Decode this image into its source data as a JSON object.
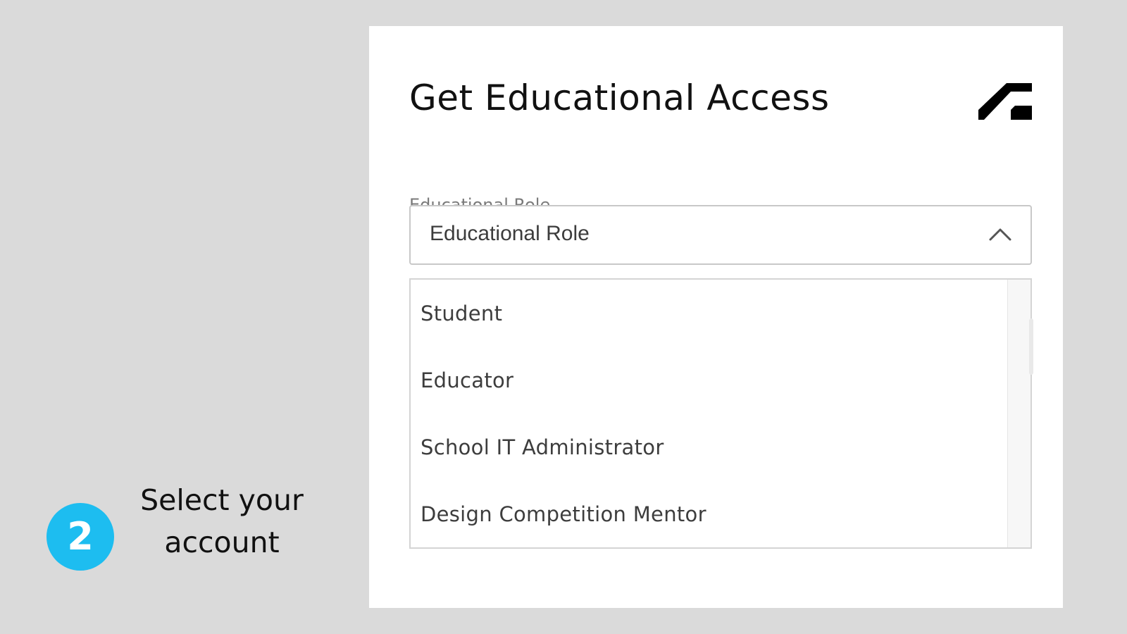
{
  "instruction": {
    "step_number": "2",
    "line1": "Select your",
    "line2": "account",
    "badge_color": "#1dbdf0"
  },
  "card": {
    "title": "Get Educational Access",
    "logo_icon": "autodesk-logo",
    "field_label": "Educational Role",
    "select": {
      "value": "Educational Role",
      "state": "expanded",
      "icon": "chevron-up-icon"
    },
    "options": [
      {
        "label": "Student"
      },
      {
        "label": "Educator"
      },
      {
        "label": "School IT Administrator"
      },
      {
        "label": "Design Competition Mentor"
      }
    ]
  },
  "colors": {
    "page_background": "#dadada",
    "card_background": "#ffffff",
    "text_primary": "#111111",
    "label_gray": "#7a7a7a"
  }
}
